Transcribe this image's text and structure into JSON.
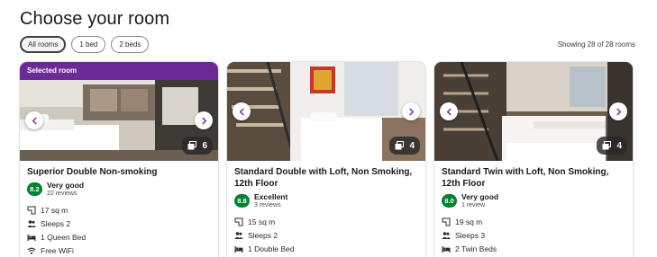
{
  "page": {
    "title": "Choose your room",
    "showing": "Showing 28 of 28 rooms"
  },
  "filters": [
    {
      "label": "All rooms",
      "active": true
    },
    {
      "label": "1 bed",
      "active": false
    },
    {
      "label": "2 beds",
      "active": false
    }
  ],
  "colors": {
    "brand_purple": "#6b2a96",
    "rating_green": "#008234"
  },
  "rooms": [
    {
      "banner": "Selected room",
      "name": "Superior Double Non-smoking",
      "photo_count": "6",
      "score": "8.2",
      "rating_label": "Very good",
      "reviews": "22 reviews",
      "features": [
        {
          "icon": "room-size-icon",
          "text": "17 sq m"
        },
        {
          "icon": "people-icon",
          "text": "Sleeps 2"
        },
        {
          "icon": "bed-icon",
          "text": "1 Queen Bed"
        },
        {
          "icon": "wifi-icon",
          "text": "Free WiFi"
        }
      ]
    },
    {
      "banner": "",
      "name": "Standard Double with Loft, Non Smoking, 12th Floor",
      "photo_count": "4",
      "score": "8.8",
      "rating_label": "Excellent",
      "reviews": "3 reviews",
      "features": [
        {
          "icon": "room-size-icon",
          "text": "15 sq m"
        },
        {
          "icon": "people-icon",
          "text": "Sleeps 2"
        },
        {
          "icon": "bed-icon",
          "text": "1 Double Bed"
        }
      ]
    },
    {
      "banner": "",
      "name": "Standard Twin with Loft, Non Smoking, 12th Floor",
      "photo_count": "4",
      "score": "8.0",
      "rating_label": "Very good",
      "reviews": "1 review",
      "features": [
        {
          "icon": "room-size-icon",
          "text": "19 sq m"
        },
        {
          "icon": "people-icon",
          "text": "Sleeps 3"
        },
        {
          "icon": "bed-icon",
          "text": "2 Twin Beds"
        }
      ]
    }
  ]
}
